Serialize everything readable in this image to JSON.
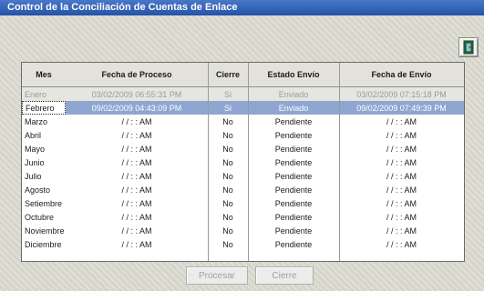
{
  "window": {
    "title": "Control de la Conciliación de Cuentas de Enlace"
  },
  "grid": {
    "headers": {
      "mes": "Mes",
      "fecha_proceso": "Fecha de Proceso",
      "cierre": "Cierre",
      "estado": "Estado Envío",
      "fecha_envio": "Fecha de Envío"
    },
    "rows": [
      {
        "mes": "Enero",
        "fecha_proceso": "03/02/2009 06:55:31 PM",
        "cierre": "Si",
        "estado": "Enviado",
        "fecha_envio": "03/02/2009 07:15:18 PM"
      },
      {
        "mes": "Febrero",
        "fecha_proceso": "09/02/2009 04:43:09 PM",
        "cierre": "Si",
        "estado": "Enviado",
        "fecha_envio": "09/02/2009 07:49:39 PM"
      },
      {
        "mes": "Marzo",
        "fecha_proceso": "/ /     : : AM",
        "cierre": "No",
        "estado": "Pendiente",
        "fecha_envio": "/ /     : : AM"
      },
      {
        "mes": "Abril",
        "fecha_proceso": "/ /     : : AM",
        "cierre": "No",
        "estado": "Pendiente",
        "fecha_envio": "/ /     : : AM"
      },
      {
        "mes": "Mayo",
        "fecha_proceso": "/ /     : : AM",
        "cierre": "No",
        "estado": "Pendiente",
        "fecha_envio": "/ /     : : AM"
      },
      {
        "mes": "Junio",
        "fecha_proceso": "/ /     : : AM",
        "cierre": "No",
        "estado": "Pendiente",
        "fecha_envio": "/ /     : : AM"
      },
      {
        "mes": "Julio",
        "fecha_proceso": "/ /     : : AM",
        "cierre": "No",
        "estado": "Pendiente",
        "fecha_envio": "/ /     : : AM"
      },
      {
        "mes": "Agosto",
        "fecha_proceso": "/ /     : : AM",
        "cierre": "No",
        "estado": "Pendiente",
        "fecha_envio": "/ /     : : AM"
      },
      {
        "mes": "Setiembre",
        "fecha_proceso": "/ /     : : AM",
        "cierre": "No",
        "estado": "Pendiente",
        "fecha_envio": "/ /     : : AM"
      },
      {
        "mes": "Octubre",
        "fecha_proceso": "/ /     : : AM",
        "cierre": "No",
        "estado": "Pendiente",
        "fecha_envio": "/ /     : : AM"
      },
      {
        "mes": "Noviembre",
        "fecha_proceso": "/ /     : : AM",
        "cierre": "No",
        "estado": "Pendiente",
        "fecha_envio": "/ /     : : AM"
      },
      {
        "mes": "Diciembre",
        "fecha_proceso": "/ /     : : AM",
        "cierre": "No",
        "estado": "Pendiente",
        "fecha_envio": "/ /     : : AM"
      }
    ],
    "selected_row": 1
  },
  "buttons": {
    "procesar": "Procesar",
    "cierre": "Cierre"
  },
  "icons": {
    "exit": "exit-door-icon"
  },
  "colors": {
    "title_bar": "#2c5ab0",
    "selection": "#8fa6d0"
  }
}
